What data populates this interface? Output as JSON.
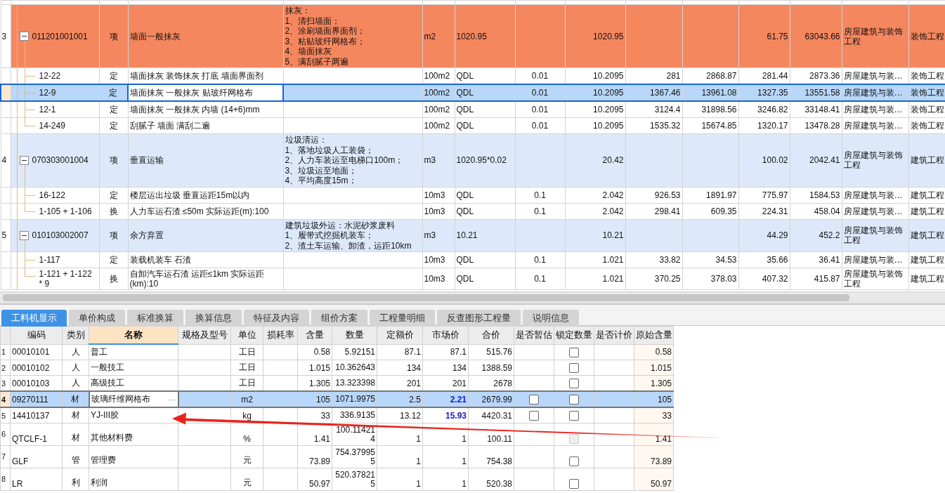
{
  "upper_table": {
    "rows": [
      {
        "kind": "item",
        "expanded": true,
        "selected": false,
        "color": "#f5875f",
        "column_1": "3",
        "column_2": "011201001001",
        "column_3": "项",
        "column_4": "墙面一般抹灰",
        "column_5": "抹灰：\n1、清扫墙面；\n2、涂刷墙面界面剂；\n3、粘贴玻纤网格布；\n4、墙面抹灰\n5、满刮腻子两遍",
        "column_6": "m2",
        "column_7": "1020.95",
        "column_9": "1020.95",
        "column_12": "61.75",
        "column_13": "63043.66",
        "column_14": "房屋建筑与装饰工程",
        "column_15": "装饰工程"
      },
      {
        "kind": "norm",
        "selected": false,
        "column_2": "12-22",
        "column_3": "定",
        "column_4": "墙面抹灰 装饰抹灰 打底 墙面界面剂",
        "column_6": "100m2",
        "column_7": "QDL",
        "column_8": "0.01",
        "column_9": "10.2095",
        "column_10": "281",
        "column_11": "2868.87",
        "column_12": "281.44",
        "column_13": "2873.36",
        "column_14": "房屋建筑与装…",
        "column_15": "装饰工程"
      },
      {
        "kind": "norm",
        "selected": true,
        "column_2": "12-9",
        "column_3": "定",
        "column_4": "墙面抹灰 一般抹灰 贴玻纤网格布",
        "column_6": "100m2",
        "column_7": "QDL",
        "column_8": "0.01",
        "column_9": "10.2095",
        "column_10": "1367.46",
        "column_11": "13961.08",
        "column_12": "1327.35",
        "column_13": "13551.58",
        "column_14": "房屋建筑与装…",
        "column_15": "装饰工程"
      },
      {
        "kind": "norm",
        "selected": false,
        "column_2": "12-1",
        "column_3": "定",
        "column_4": "墙面抹灰 一般抹灰 内墙 (14+6)mm",
        "column_6": "100m2",
        "column_7": "QDL",
        "column_8": "0.01",
        "column_9": "10.2095",
        "column_10": "3124.4",
        "column_11": "31898.56",
        "column_12": "3246.82",
        "column_13": "33148.41",
        "column_14": "房屋建筑与装…",
        "column_15": "装饰工程"
      },
      {
        "kind": "norm",
        "selected": false,
        "column_2": "14-249",
        "column_3": "定",
        "column_4": "刮腻子 墙面 满刮二遍",
        "column_6": "100m2",
        "column_7": "QDL",
        "column_8": "0.01",
        "column_9": "10.2095",
        "column_10": "1535.32",
        "column_11": "15674.85",
        "column_12": "1320.17",
        "column_13": "13478.28",
        "column_14": "房屋建筑与装…",
        "column_15": "装饰工程"
      },
      {
        "kind": "item",
        "expanded": true,
        "selected": false,
        "color": "#dde9fb",
        "column_1": "4",
        "column_2": "070303001004",
        "column_3": "项",
        "column_4": "垂直运输",
        "column_5": "垃圾清运：\n1、落地垃圾人工装袋；\n2、人力车装运至电梯口100m；\n3、垃圾运至地面；\n4、平均高度15m；",
        "column_6": "m3",
        "column_7": "1020.95*0.02",
        "column_9": "20.42",
        "column_12": "100.02",
        "column_13": "2042.41",
        "column_14": "房屋建筑与装饰工程",
        "column_15": "建筑工程"
      },
      {
        "kind": "norm",
        "selected": false,
        "column_2": "16-122",
        "column_3": "定",
        "column_4": "楼层运出垃圾 垂直运距15m以内",
        "column_6": "10m3",
        "column_7": "QDL",
        "column_8": "0.1",
        "column_9": "2.042",
        "column_10": "926.53",
        "column_11": "1891.97",
        "column_12": "775.97",
        "column_13": "1584.53",
        "column_14": "房屋建筑与装…",
        "column_15": "建筑工程"
      },
      {
        "kind": "norm",
        "selected": false,
        "column_2": "1-105 + 1-106",
        "column_3": "换",
        "column_4": "人力车运石渣 ≤50m  实际运距(m):100",
        "column_6": "10m3",
        "column_7": "QDL",
        "column_8": "0.1",
        "column_9": "2.042",
        "column_10": "298.41",
        "column_11": "609.35",
        "column_12": "224.31",
        "column_13": "458.04",
        "column_14": "房屋建筑与装…",
        "column_15": "建筑工程"
      },
      {
        "kind": "item",
        "expanded": true,
        "selected": false,
        "color": "#dde9fb",
        "column_1": "5",
        "column_2": "010103002007",
        "column_3": "项",
        "column_4": "余方弃置",
        "column_5": "建筑垃圾外运：水泥砂浆废料\n1、履带式挖掘机装车；\n2、渣土车运输、卸渣，运距10km",
        "column_6": "m3",
        "column_7": "10.21",
        "column_9": "10.21",
        "column_12": "44.29",
        "column_13": "452.2",
        "column_14": "房屋建筑与装饰工程",
        "column_15": "建筑工程"
      },
      {
        "kind": "norm",
        "selected": false,
        "column_2": "1-117",
        "column_3": "定",
        "column_4": "装载机装车 石渣",
        "column_6": "10m3",
        "column_7": "QDL",
        "column_8": "0.1",
        "column_9": "1.021",
        "column_10": "33.82",
        "column_11": "34.53",
        "column_12": "35.66",
        "column_13": "36.41",
        "column_14": "房屋建筑与装…",
        "column_15": "建筑工程"
      },
      {
        "kind": "norm",
        "selected": false,
        "column_2": "1-121 + 1-122 * 9",
        "column_3": "换",
        "column_4": "自卸汽车运石渣 运距≤1km  实际运距(km):10",
        "column_6": "10m3",
        "column_7": "QDL",
        "column_8": "0.1",
        "column_9": "1.021",
        "column_10": "370.25",
        "column_11": "378.03",
        "column_12": "407.32",
        "column_13": "415.87",
        "column_14": "房屋建筑与装饰工程",
        "column_15": "建筑工程"
      }
    ]
  },
  "tabs": [
    {
      "label": "工料机显示",
      "selected": true
    },
    {
      "label": "单价构成",
      "selected": false
    },
    {
      "label": "标准换算",
      "selected": false
    },
    {
      "label": "换算信息",
      "selected": false
    },
    {
      "label": "特征及内容",
      "selected": false
    },
    {
      "label": "组价方案",
      "selected": false
    },
    {
      "label": "工程量明细",
      "selected": false
    },
    {
      "label": "反查图形工程量",
      "selected": false
    },
    {
      "label": "说明信息",
      "selected": false
    }
  ],
  "resource_table": {
    "columns": [
      {
        "label": "编码",
        "selected": false
      },
      {
        "label": "类别",
        "selected": false
      },
      {
        "label": "名称",
        "selected": true
      },
      {
        "label": "规格及型号",
        "selected": false
      },
      {
        "label": "单位",
        "selected": false
      },
      {
        "label": "损耗率",
        "selected": false
      },
      {
        "label": "含量",
        "selected": false
      },
      {
        "label": "数量",
        "selected": false
      },
      {
        "label": "定额价",
        "selected": false
      },
      {
        "label": "市场价",
        "selected": false
      },
      {
        "label": "合价",
        "selected": false
      },
      {
        "label": "是否暂估",
        "selected": false
      },
      {
        "label": "锁定数量",
        "selected": false
      },
      {
        "label": "是否计价",
        "selected": false
      },
      {
        "label": "原始含量",
        "selected": false
      }
    ],
    "rows": [
      {
        "index": "1",
        "code": "00010101",
        "category": "人",
        "name": "普工",
        "unit": "工日",
        "content": "0.58",
        "quantity": "5.92151",
        "quota_price": "87.1",
        "market_price": "87.1",
        "adjusted": false,
        "total": "515.76",
        "locked": {
          "checked": false,
          "disabled": false
        },
        "original": "0.58",
        "selected": false
      },
      {
        "index": "2",
        "code": "00010102",
        "category": "人",
        "name": "一般技工",
        "unit": "工日",
        "content": "1.015",
        "quantity": "10.362643",
        "quota_price": "134",
        "market_price": "134",
        "adjusted": false,
        "total": "1388.59",
        "locked": {
          "checked": false,
          "disabled": false
        },
        "original": "1.015",
        "selected": false
      },
      {
        "index": "3",
        "code": "00010103",
        "category": "人",
        "name": "高级技工",
        "unit": "工日",
        "content": "1.305",
        "quantity": "13.323398",
        "quota_price": "201",
        "market_price": "201",
        "adjusted": false,
        "total": "2678",
        "locked": {
          "checked": false,
          "disabled": false
        },
        "original": "1.305",
        "selected": false
      },
      {
        "index": "4",
        "code": "09270111",
        "category": "材",
        "name": "玻璃纤维网格布",
        "name_button": "···",
        "unit": "m2",
        "content": "105",
        "quantity": "1071.9975",
        "quota_price": "2.5",
        "market_price": "2.21",
        "adjusted": true,
        "total": "2679.99",
        "provisional": {
          "checked": false
        },
        "locked": {
          "checked": false,
          "disabled": false
        },
        "original": "105",
        "selected": true
      },
      {
        "index": "5",
        "code": "14410137",
        "category": "材",
        "name": "YJ-III胶",
        "unit": "kg",
        "content": "33",
        "quantity": "336.9135",
        "quota_price": "13.12",
        "market_price": "15.93",
        "adjusted": true,
        "total": "4420.31",
        "provisional": {
          "checked": false
        },
        "locked": {
          "checked": false,
          "disabled": false
        },
        "original": "33",
        "selected": false
      },
      {
        "index": "6",
        "code": "QTCLF-1",
        "category": "材",
        "name": "其他材料费",
        "unit": "%",
        "content": "1.41",
        "quantity": "100.114214",
        "quota_price": "1",
        "market_price": "1",
        "adjusted": false,
        "total": "100.11",
        "locked": {
          "checked": false,
          "disabled": true
        },
        "original": "1.41",
        "selected": false
      },
      {
        "index": "7",
        "code": "GLF",
        "category": "管",
        "name": "管理费",
        "unit": "元",
        "content": "73.89",
        "quantity": "754.379955",
        "quota_price": "1",
        "market_price": "1",
        "adjusted": false,
        "total": "754.38",
        "locked": {
          "checked": false,
          "disabled": false
        },
        "original": "73.89",
        "selected": false
      },
      {
        "index": "8",
        "code": "LR",
        "category": "利",
        "name": "利润",
        "unit": "元",
        "content": "50.97",
        "quantity": "520.378215",
        "quota_price": "1",
        "market_price": "1",
        "adjusted": false,
        "total": "520.38",
        "locked": {
          "checked": false,
          "disabled": false
        },
        "original": "50.97",
        "selected": false
      }
    ]
  }
}
